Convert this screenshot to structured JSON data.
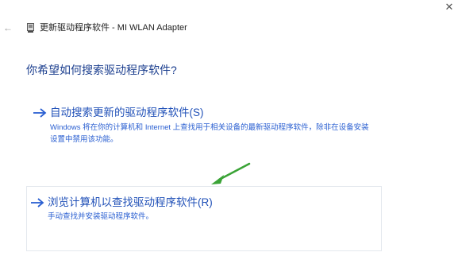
{
  "window": {
    "close_glyph": "✕",
    "back_glyph": "←",
    "title": "更新驱动程序软件 - MI WLAN Adapter",
    "title_icon": "network-adapter-icon"
  },
  "heading": "你希望如何搜索驱动程序软件?",
  "options": [
    {
      "icon": "arrow-right-icon",
      "title": "自动搜索更新的驱动程序软件(S)",
      "desc": "Windows 将在你的计算机和 Internet 上查找用于相关设备的最新驱动程序软件，除非在设备安装设置中禁用该功能。"
    },
    {
      "icon": "arrow-right-icon",
      "title": "浏览计算机以查找驱动程序软件(R)",
      "desc": "手动查找并安装驱动程序软件。"
    }
  ],
  "colors": {
    "heading": "#1c3f8f",
    "link": "#2151b8",
    "arrow": "#2a5fd1",
    "pointer": "#3aa336"
  },
  "annotation_icon": "green-arrow-icon"
}
